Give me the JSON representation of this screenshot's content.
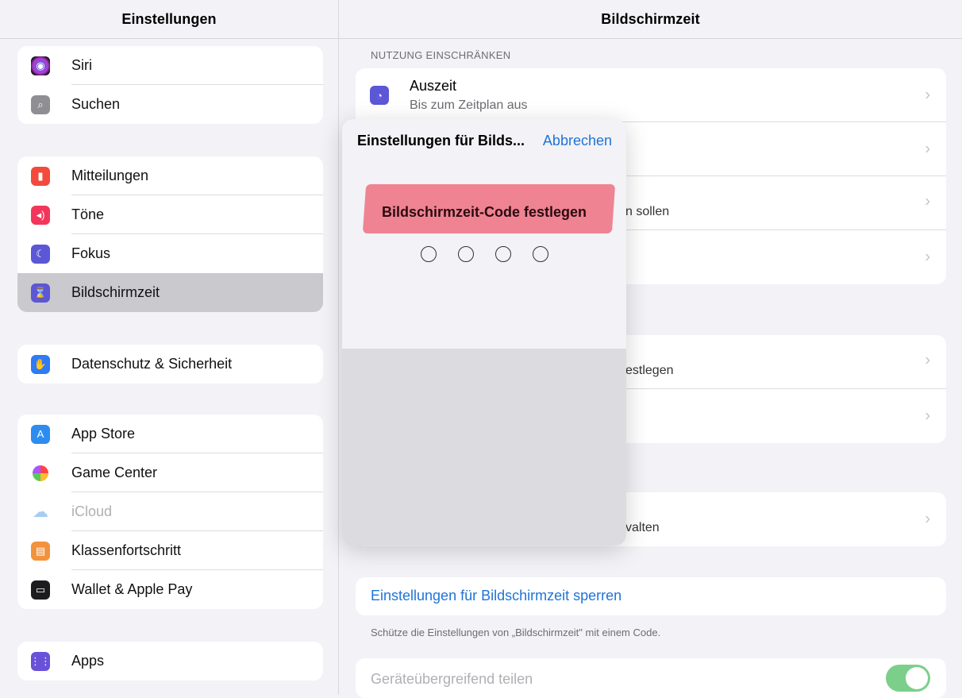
{
  "sidebar": {
    "title": "Einstellungen",
    "groups": [
      [
        {
          "label": "Siri",
          "icon": "siri-icon"
        },
        {
          "label": "Suchen",
          "icon": "search-icon"
        }
      ],
      [
        {
          "label": "Mitteilungen",
          "icon": "notifications-icon"
        },
        {
          "label": "Töne",
          "icon": "sound-icon"
        },
        {
          "label": "Fokus",
          "icon": "moon-icon"
        },
        {
          "label": "Bildschirmzeit",
          "icon": "hourglass-icon",
          "selected": true
        }
      ],
      [
        {
          "label": "Datenschutz & Sicherheit",
          "icon": "hand-icon"
        }
      ],
      [
        {
          "label": "App Store",
          "icon": "app-store-icon"
        },
        {
          "label": "Game Center",
          "icon": "game-center-icon"
        },
        {
          "label": "iCloud",
          "icon": "cloud-icon",
          "disabled": true
        },
        {
          "label": "Klassenfortschritt",
          "icon": "chart-icon"
        },
        {
          "label": "Wallet & Apple Pay",
          "icon": "wallet-icon"
        }
      ],
      [
        {
          "label": "Apps",
          "icon": "apps-grid-icon"
        }
      ]
    ]
  },
  "detail": {
    "title": "Bildschirmzeit",
    "section_limits": "NUTZUNG EINSCHRÄNKEN",
    "auszeit_title": "Auszeit",
    "auszeit_sub": "Bis zum Zeitplan aus",
    "row3_partial": "n sollen",
    "row5_partial": "estlegen",
    "row7_partial": "valten",
    "lock_label": "Einstellungen für Bildschirmzeit sperren",
    "lock_footnote": "Schütze die Einstellungen von „Bildschirmzeit\" mit einem Code.",
    "share_label": "Geräteübergreifend teilen",
    "share_on": true
  },
  "popover": {
    "title": "Einstellungen für Bilds...",
    "cancel": "Abbrechen",
    "heading": "Bildschirmzeit-Code festlegen",
    "code_length": 4
  },
  "colors": {
    "accent": "#1f74d6",
    "highlight": "#ee7c8c",
    "toggle_on": "#7ccf8b"
  }
}
